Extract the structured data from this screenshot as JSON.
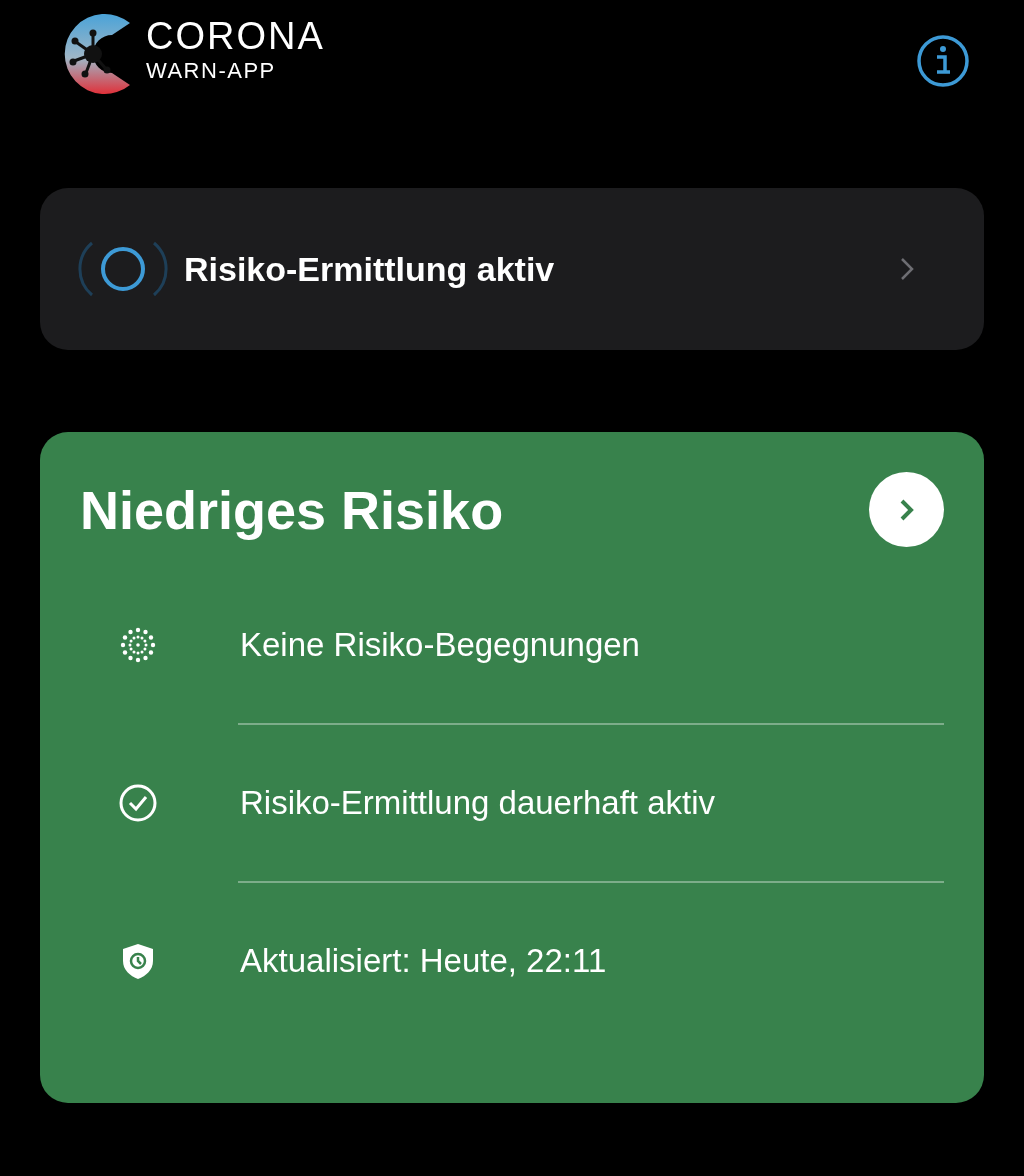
{
  "header": {
    "logo_line1": "CORONA",
    "logo_line2": "WARN-APP"
  },
  "status_card": {
    "label": "Risiko-Ermittlung aktiv"
  },
  "risk_card": {
    "title": "Niedriges Risiko",
    "rows": [
      {
        "kind": "encounters",
        "text": "Keine Risiko-Begegnungen"
      },
      {
        "kind": "check",
        "text": "Risiko-Ermittlung dauerhaft aktiv"
      },
      {
        "kind": "updated",
        "text": "Aktualisiert: Heute, 22:11"
      }
    ]
  }
}
